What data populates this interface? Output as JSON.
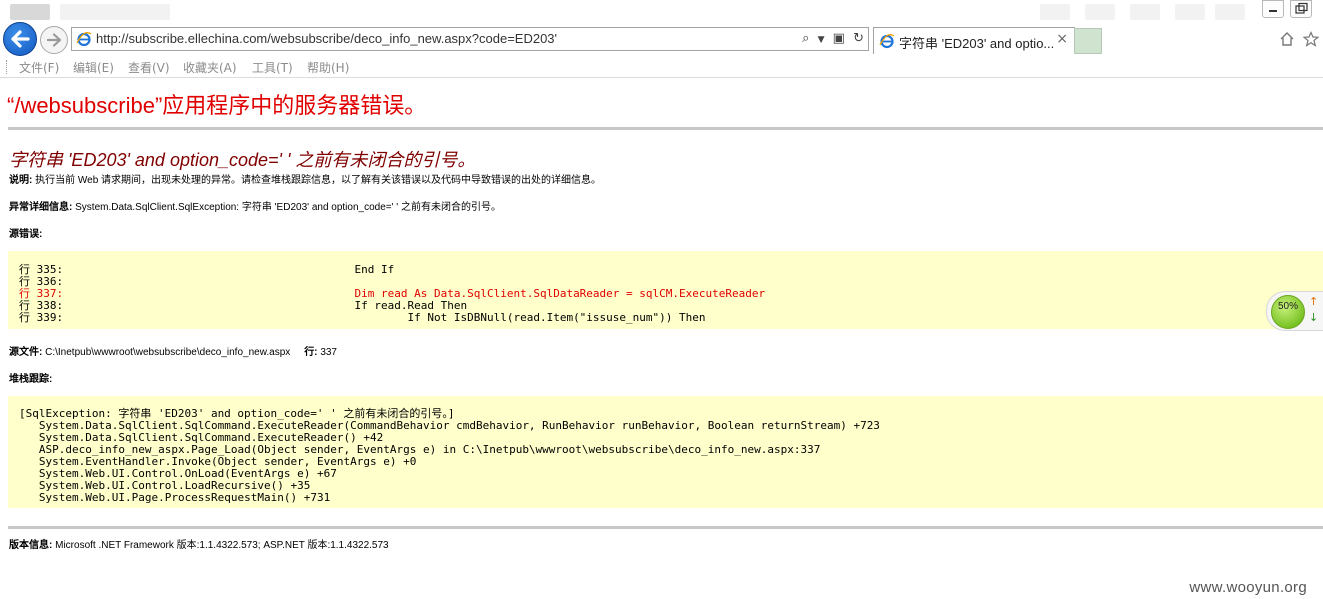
{
  "browser": {
    "address_url": "http://subscribe.ellechina.com/websubscribe/deco_info_new.aspx?code=ED203'",
    "tab_title": "字符串 'ED203' and optio...",
    "tab_close": "×",
    "menu": [
      "文件(F)",
      "编辑(E)",
      "查看(V)",
      "收藏夹(A)",
      "工具(T)",
      "帮助(H)"
    ],
    "zoom_level": "50%"
  },
  "error": {
    "title": "“/websubscribe”应用程序中的服务器错误。",
    "message": "字符串 'ED203' and option_code=' ' 之前有未闭合的引号。",
    "description_label": "说明:",
    "description_text": "执行当前 Web 请求期间，出现未处理的异常。请检查堆栈跟踪信息，以了解有关该错误以及代码中导致错误的出处的详细信息。",
    "exception_label": "异常详细信息:",
    "exception_text": "System.Data.SqlClient.SqlException: 字符串 'ED203' and option_code=' ' 之前有未闭合的引号。",
    "source_error_label": "源错误:",
    "source_lines": [
      {
        "num": "行 335:",
        "code": "                        End If",
        "highlight": false
      },
      {
        "num": "行 336:",
        "code": "",
        "highlight": false
      },
      {
        "num": "行 337:",
        "code": "                        Dim read As Data.SqlClient.SqlDataReader = sqlCM.ExecuteReader",
        "highlight": true
      },
      {
        "num": "行 338:",
        "code": "                        If read.Read Then",
        "highlight": false
      },
      {
        "num": "行 339:",
        "code": "                                If Not IsDBNull(read.Item(\"issuse_num\")) Then",
        "highlight": false
      }
    ],
    "source_file_label": "源文件:",
    "source_file": "C:\\Inetpub\\wwwroot\\websubscribe\\deco_info_new.aspx",
    "line_label": "行:",
    "line_value": "337",
    "stack_label": "堆栈跟踪:",
    "stack_lines": [
      "[SqlException: 字符串 'ED203' and option_code=' ' 之前有未闭合的引号。]",
      "   System.Data.SqlClient.SqlCommand.ExecuteReader(CommandBehavior cmdBehavior, RunBehavior runBehavior, Boolean returnStream) +723",
      "   System.Data.SqlClient.SqlCommand.ExecuteReader() +42",
      "   ASP.deco_info_new_aspx.Page_Load(Object sender, EventArgs e) in C:\\Inetpub\\wwwroot\\websubscribe\\deco_info_new.aspx:337",
      "   System.EventHandler.Invoke(Object sender, EventArgs e) +0",
      "   System.Web.UI.Control.OnLoad(EventArgs e) +67",
      "   System.Web.UI.Control.LoadRecursive() +35",
      "   System.Web.UI.Page.ProcessRequestMain() +731"
    ],
    "version_label": "版本信息:",
    "version_text": "Microsoft .NET Framework 版本:1.1.4322.573; ASP.NET 版本:1.1.4322.573"
  },
  "watermark": "www.wooyun.org",
  "colors": {
    "error_title": "#e00000",
    "error_message": "#800000",
    "code_background": "#ffffcc",
    "highlight_line": "#e00000"
  }
}
